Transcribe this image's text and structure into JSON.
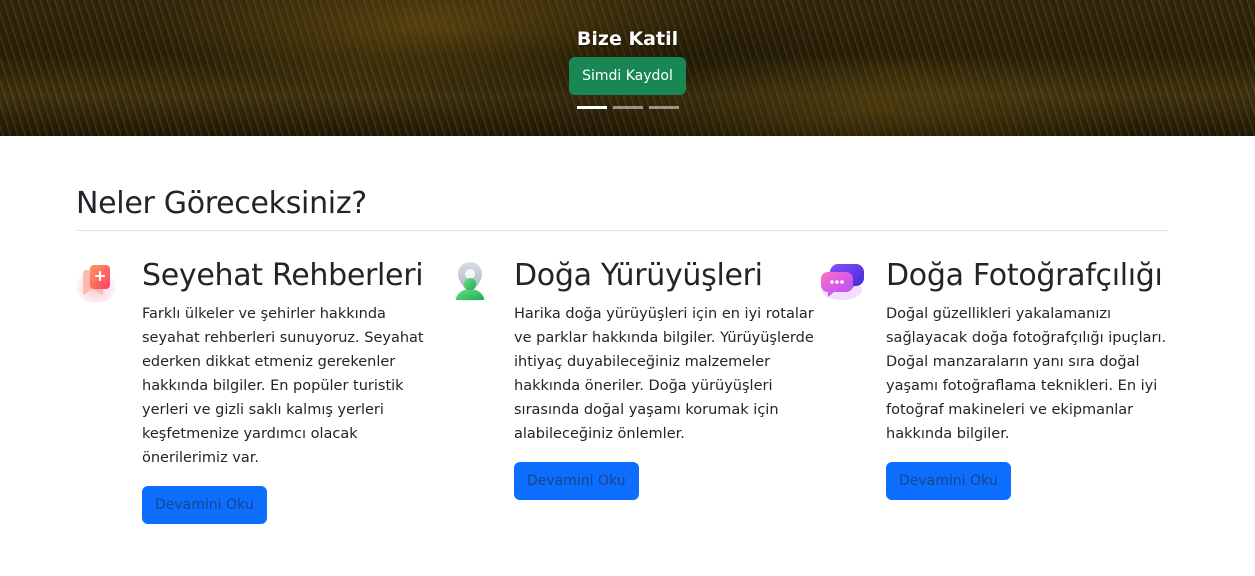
{
  "hero": {
    "title": "Bize Katil",
    "cta_label": "Simdi Kaydol",
    "slides_count": 3,
    "active_slide": 1
  },
  "section": {
    "title": "Neler Göreceksiniz?"
  },
  "features": [
    {
      "icon": "map-bookmark-icon",
      "title": "Seyehat Rehberleri",
      "text": "Farklı ülkeler ve şehirler hakkında seyahat rehberleri sunuyoruz. Seyahat ederken dikkat etmeniz gerekenler hakkında bilgiler. En popüler turistik yerleri ve gizli saklı kalmış yerleri keşfetmenize yardımcı olacak önerilerimiz var.",
      "button_label": "Devamini Oku"
    },
    {
      "icon": "location-user-icon",
      "title": "Doğa Yürüyüşleri",
      "text": "Harika doğa yürüyüşleri için en iyi rotalar ve parklar hakkında bilgiler. Yürüyüşlerde ihtiyaç duyabileceğiniz malzemeler hakkında öneriler. Doğa yürüyüşleri sırasında doğal yaşamı korumak için alabileceğiniz önlemler.",
      "button_label": "Devamini Oku"
    },
    {
      "icon": "chat-bubbles-icon",
      "title": "Doğa Fotoğrafçılığı",
      "text": "Doğal güzellikleri yakalamanızı sağlayacak doğa fotoğrafçılığı ipuçları. Doğal manzaraların yanı sıra doğal yaşamı fotoğraflama teknikleri. En iyi fotoğraf makineleri ve ekipmanlar hakkında bilgiler.",
      "button_label": "Devamini Oku"
    }
  ],
  "colors": {
    "cta_green": "#198754",
    "button_blue": "#0d6efd",
    "text_dark": "#212529"
  }
}
